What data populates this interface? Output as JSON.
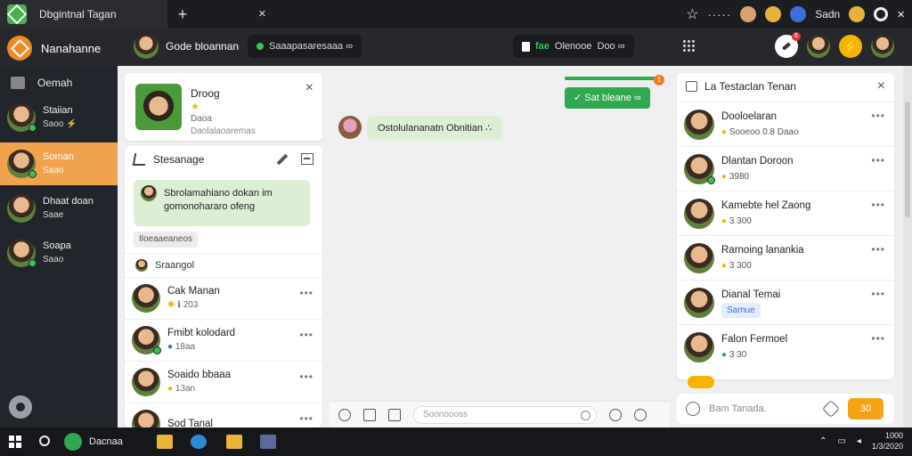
{
  "titlebar": {
    "tab_title": "Dbgintnal Tagan",
    "new_tab": "+",
    "close_tab": "×",
    "more": "·····",
    "user_name": "Sadn",
    "close_window": "×"
  },
  "header": {
    "brand": "Nanahanne",
    "chat_title": "Gode bloannan",
    "pill_left": "Saaapasaresaaa ∞",
    "pill_right": {
      "label": "fae",
      "mid": "Olenooe",
      "end": "Doo ∞"
    }
  },
  "sidebar": {
    "home_label": "Oemah",
    "items": [
      {
        "name": "Staiian",
        "sub": "Saoo ⚡"
      },
      {
        "name": "Soman",
        "sub": "Saao"
      },
      {
        "name": "Dhaat doan",
        "sub": "Saae"
      },
      {
        "name": "Soapa",
        "sub": "Saao"
      }
    ]
  },
  "profile": {
    "name": "Droog",
    "line2": "★",
    "line3": "Daoa",
    "line4": "Daolalaoaremas"
  },
  "conversation": {
    "title": "Stesanage",
    "pinned_message": "Sbrolamahiano dokan im gomonohararo ofeng",
    "tag": "Iloeaaeaneos",
    "section_title": "Sraangol",
    "items": [
      {
        "name": "Cak Manan",
        "sub": "ℹ 203"
      },
      {
        "name": "Fmibt kolodard",
        "sub": "18aa"
      },
      {
        "name": "Soaido bbaaa",
        "sub": "13an"
      },
      {
        "name": "Sod Tanal",
        "sub": ""
      }
    ]
  },
  "chat": {
    "incoming": "Ostolulananatn Obnitian ∴",
    "outgoing": "✓ Sat bleane ∞",
    "notif_count": "1",
    "composer_placeholder": "Soonoooss"
  },
  "members": {
    "title": "La Testaclan Tenan",
    "items": [
      {
        "name": "Dooloelaran",
        "sub": "Sooeoo 0.8 Daao"
      },
      {
        "name": "Dlantan Doroon",
        "sub": "3980"
      },
      {
        "name": "Kamebte hel Zaong",
        "sub": "3 300"
      },
      {
        "name": "Rarnoing lanankia",
        "sub": "3 300"
      },
      {
        "name": "Dianal Temai",
        "sub": "Samue"
      },
      {
        "name": "Falon Fermoel",
        "sub": "3 30"
      }
    ],
    "reply_placeholder": "Bam Tanada.",
    "send_label": "30"
  },
  "taskbar": {
    "app_label": "Dacnaa",
    "time": "1000",
    "date": "1/3/2020"
  },
  "colors": {
    "accent_orange": "#f0a24c",
    "accent_green": "#2fa84f",
    "dark_bg": "#22252b"
  }
}
